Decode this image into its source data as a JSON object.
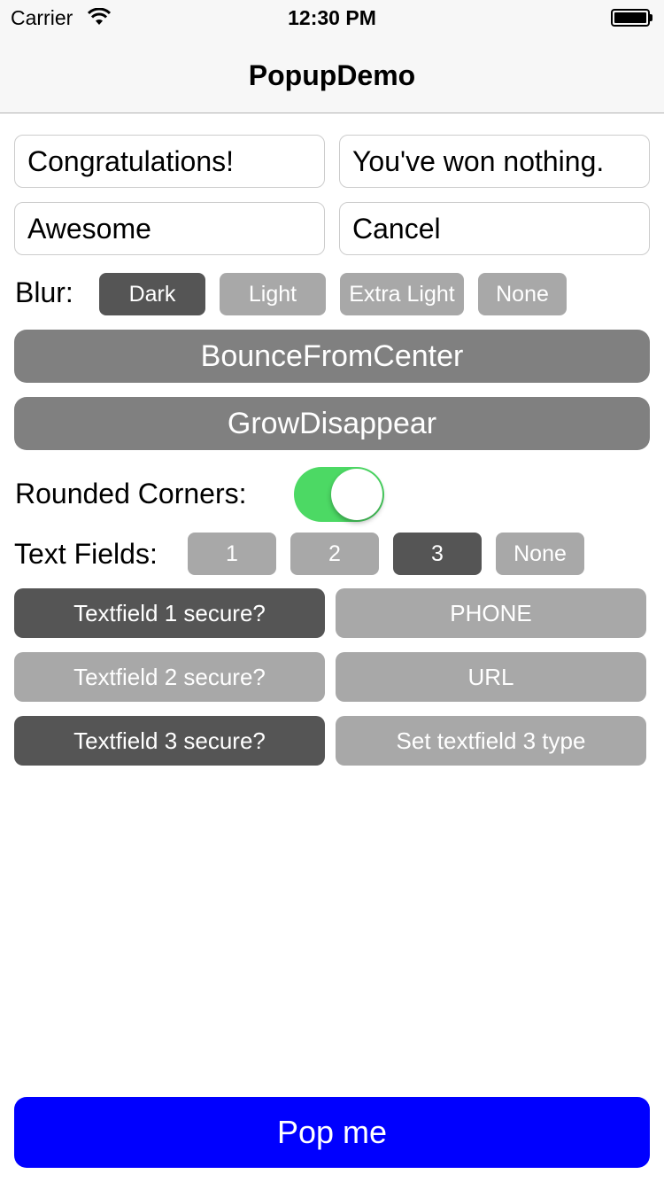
{
  "status_bar": {
    "carrier": "Carrier",
    "time": "12:30 PM"
  },
  "nav": {
    "title": "PopupDemo"
  },
  "fields": {
    "title_value": "Congratulations!",
    "subtitle_value": "You've won nothing.",
    "success_value": "Awesome",
    "cancel_value": "Cancel"
  },
  "blur": {
    "label": "Blur:",
    "options": [
      "Dark",
      "Light",
      "Extra Light",
      "None"
    ],
    "selected": "Dark"
  },
  "animations": {
    "incoming": "BounceFromCenter",
    "outgoing": "GrowDisappear"
  },
  "rounded_corners": {
    "label": "Rounded Corners:",
    "on": true
  },
  "text_fields": {
    "label": "Text Fields:",
    "options": [
      "1",
      "2",
      "3",
      "None"
    ],
    "selected": "3"
  },
  "textfield_options": {
    "tf1_secure": "Textfield 1 secure?",
    "tf1_type": "PHONE",
    "tf2_secure": "Textfield 2 secure?",
    "tf2_type": "URL",
    "tf3_secure": "Textfield 3 secure?",
    "tf3_type": "Set textfield 3 type"
  },
  "pop_button": "Pop me",
  "colors": {
    "dark_button": "#555555",
    "light_button": "#a8a8a8",
    "wide_button": "#808080",
    "toggle_on": "#4cd964",
    "pop_button": "#0000ff"
  },
  "icons": [
    "wifi-icon",
    "battery-icon"
  ]
}
